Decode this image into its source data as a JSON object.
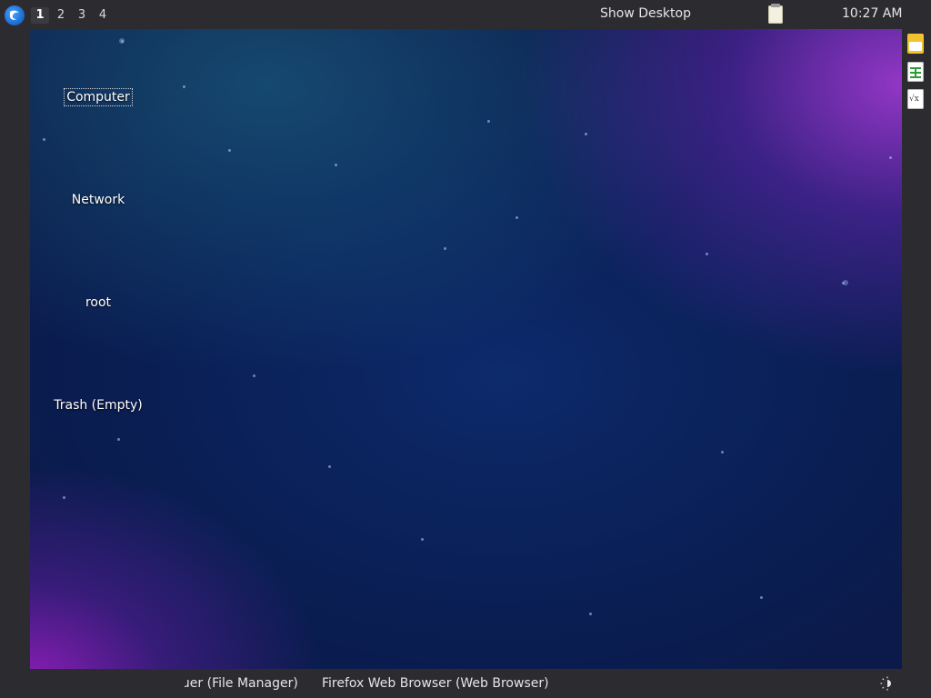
{
  "top_panel": {
    "workspaces": [
      "1",
      "2",
      "3",
      "4"
    ],
    "active_workspace": "1",
    "show_desktop_label": "Show Desktop",
    "clock": "10:27 AM",
    "tray_icon": "notes-icon",
    "menu_icon": "distro-logo-icon"
  },
  "desktop": {
    "icons": [
      {
        "label": "Computer",
        "selected": true
      },
      {
        "label": "Network"
      },
      {
        "label": "root"
      },
      {
        "label": "Trash (Empty)"
      }
    ],
    "side_icons": [
      "folder-icon",
      "spreadsheet-icon",
      "formula-document-icon"
    ]
  },
  "bottom_panel": {
    "tasks": [
      {
        "label": "ɹer (File Manager)"
      },
      {
        "label": "Firefox Web Browser (Web Browser)"
      }
    ],
    "tray_icon": "night-mode-icon"
  },
  "colors": {
    "panel_bg": "#2c2c30",
    "panel_text": "#e6e6e6",
    "wallpaper_base": "#0b1d55",
    "wallpaper_accent": "#a83cdc"
  }
}
